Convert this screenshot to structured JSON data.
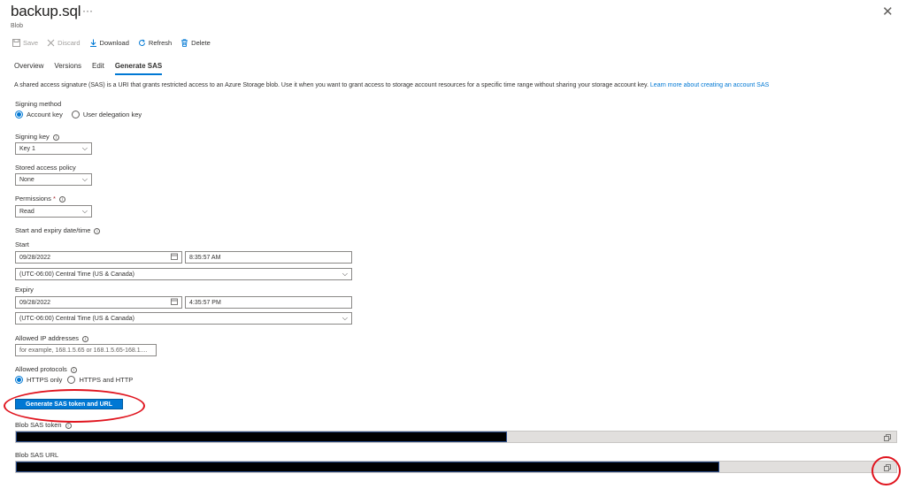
{
  "header": {
    "title": "backup.sql",
    "more_label": "···",
    "subtitle": "Blob",
    "close_label": "✕"
  },
  "toolbar": {
    "save": "Save",
    "discard": "Discard",
    "download": "Download",
    "refresh": "Refresh",
    "delete": "Delete"
  },
  "tabs": [
    "Overview",
    "Versions",
    "Edit",
    "Generate SAS"
  ],
  "active_tab": "Generate SAS",
  "description": "A shared access signature (SAS) is a URI that grants restricted access to an Azure Storage blob. Use it when you want to grant access to storage account resources for a specific time range without sharing your storage account key.",
  "learn_more": "Learn more about creating an account SAS",
  "signing_method": {
    "label": "Signing method",
    "options": [
      "Account key",
      "User delegation key"
    ],
    "selected": "Account key"
  },
  "signing_key": {
    "label": "Signing key",
    "value": "Key 1"
  },
  "stored_policy": {
    "label": "Stored access policy",
    "value": "None"
  },
  "permissions": {
    "label": "Permissions",
    "required_mark": "*",
    "value": "Read"
  },
  "datetime": {
    "label": "Start and expiry date/time",
    "start_label": "Start",
    "start_date": "09/28/2022",
    "start_time": "8:35:57 AM",
    "start_tz": "(UTC-06:00) Central Time (US & Canada)",
    "expiry_label": "Expiry",
    "expiry_date": "09/28/2022",
    "expiry_time": "4:35:57 PM",
    "expiry_tz": "(UTC-06:00) Central Time (US & Canada)"
  },
  "ip": {
    "label": "Allowed IP addresses",
    "placeholder": "for example, 168.1.5.65 or 168.1.5.65-168.1...."
  },
  "protocols": {
    "label": "Allowed protocols",
    "options": [
      "HTTPS only",
      "HTTPS and HTTP"
    ],
    "selected": "HTTPS only"
  },
  "generate_button": "Generate SAS token and URL",
  "sas_token": {
    "label": "Blob SAS token"
  },
  "sas_url": {
    "label": "Blob SAS URL"
  },
  "colors": {
    "accent": "#0078d4",
    "annotation": "#e0141e",
    "redaction": "#000000"
  }
}
